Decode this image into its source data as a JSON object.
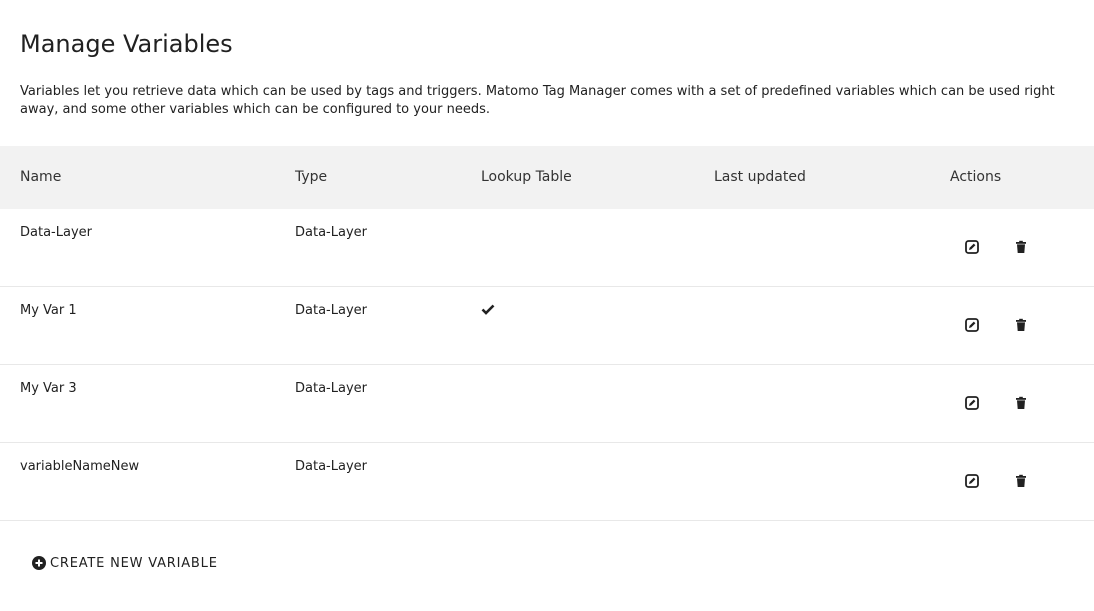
{
  "page": {
    "title": "Manage Variables",
    "description": "Variables let you retrieve data which can be used by tags and triggers. Matomo Tag Manager comes with a set of predefined variables which can be used right away, and some other variables which can be configured to your needs."
  },
  "table": {
    "headers": {
      "name": "Name",
      "type": "Type",
      "lookup": "Lookup Table",
      "updated": "Last updated",
      "actions": "Actions"
    },
    "rows": [
      {
        "name": "Data-Layer",
        "type": "Data-Layer",
        "lookup": false,
        "updated": ""
      },
      {
        "name": "My Var 1",
        "type": "Data-Layer",
        "lookup": true,
        "updated": ""
      },
      {
        "name": "My Var 3",
        "type": "Data-Layer",
        "lookup": false,
        "updated": ""
      },
      {
        "name": "variableNameNew",
        "type": "Data-Layer",
        "lookup": false,
        "updated": ""
      }
    ]
  },
  "create_button": {
    "label": "CREATE NEW VARIABLE",
    "icon": "plus-circle-icon"
  },
  "icons": {
    "edit": "edit-icon",
    "delete": "trash-icon",
    "lookup": "checkmark-icon"
  }
}
